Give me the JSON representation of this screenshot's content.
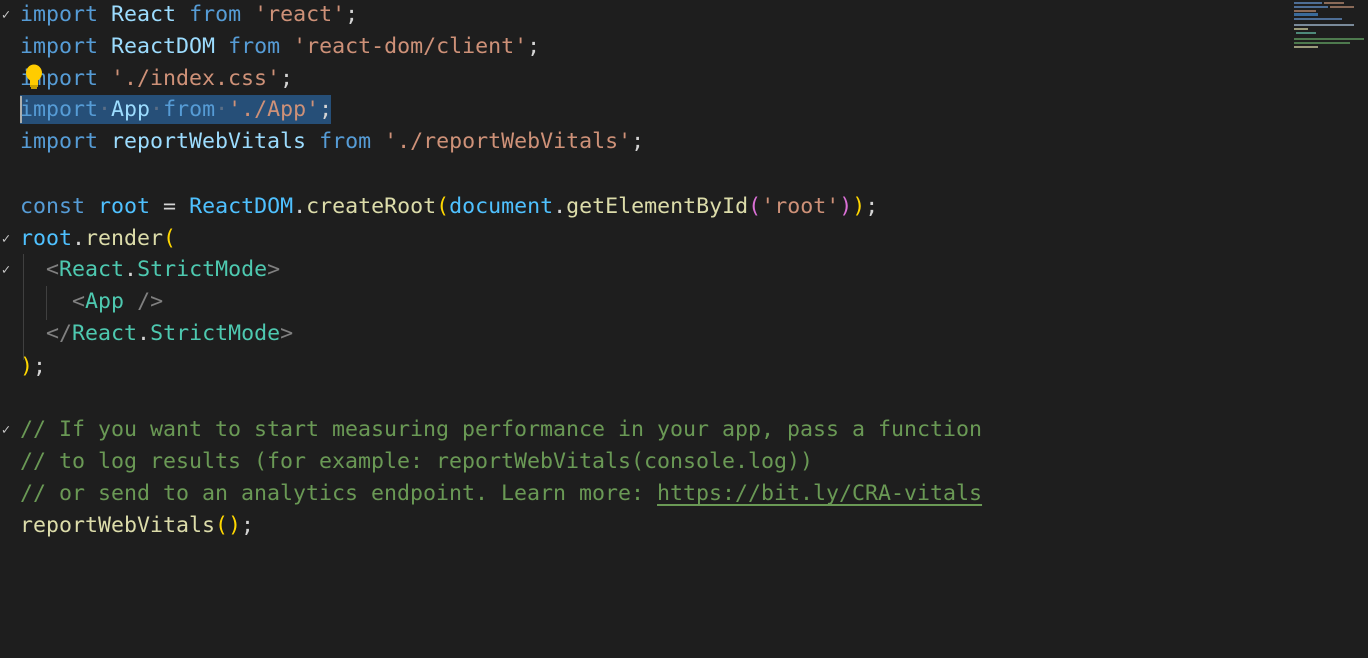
{
  "editor": {
    "lines": [
      {
        "fold": "✓",
        "tokens": [
          [
            "import",
            "kw"
          ],
          [
            " "
          ],
          [
            "React",
            "id"
          ],
          [
            " "
          ],
          [
            "from",
            "kw"
          ],
          [
            " "
          ],
          [
            "'react'",
            "str"
          ],
          [
            ";",
            "pun"
          ]
        ]
      },
      {
        "fold": "",
        "tokens": [
          [
            "import",
            "kw"
          ],
          [
            " "
          ],
          [
            "ReactDOM",
            "id"
          ],
          [
            " "
          ],
          [
            "from",
            "kw"
          ],
          [
            " "
          ],
          [
            "'react-dom/client'",
            "str"
          ],
          [
            ";",
            "pun"
          ]
        ]
      },
      {
        "fold": "",
        "tokens": [
          [
            "import",
            "kw"
          ],
          [
            " "
          ],
          [
            "'./index.css'",
            "str"
          ],
          [
            ";",
            "pun"
          ]
        ]
      },
      {
        "fold": "",
        "tokens": [
          [
            "import",
            "kw"
          ],
          [
            " "
          ],
          [
            "App",
            "id"
          ],
          [
            " "
          ],
          [
            "from",
            "kw"
          ],
          [
            " "
          ],
          [
            "'./App'",
            "str"
          ],
          [
            ";",
            "pun"
          ]
        ]
      },
      {
        "fold": "",
        "tokens": [
          [
            "import",
            "kw"
          ],
          [
            " "
          ],
          [
            "reportWebVitals",
            "id"
          ],
          [
            " "
          ],
          [
            "from",
            "kw"
          ],
          [
            " "
          ],
          [
            "'./reportWebVitals'",
            "str"
          ],
          [
            ";",
            "pun"
          ]
        ]
      },
      {
        "fold": "",
        "tokens": []
      },
      {
        "fold": "",
        "tokens": [
          [
            "const",
            "kw"
          ],
          [
            " "
          ],
          [
            "root",
            "var"
          ],
          [
            " = "
          ],
          [
            "ReactDOM",
            "var"
          ],
          [
            "."
          ],
          [
            "createRoot",
            "fn"
          ],
          [
            "(",
            "br1"
          ],
          [
            "document",
            "var"
          ],
          [
            "."
          ],
          [
            "getElementById",
            "fn"
          ],
          [
            "(",
            "br2"
          ],
          [
            "'root'",
            "str"
          ],
          [
            ")",
            "br2"
          ],
          [
            ")",
            "br1"
          ],
          [
            ";",
            "pun"
          ]
        ]
      },
      {
        "fold": "✓",
        "tokens": [
          [
            "root",
            "var"
          ],
          [
            "."
          ],
          [
            "render",
            "fn"
          ],
          [
            "(",
            "br1"
          ]
        ]
      },
      {
        "fold": "✓",
        "tokens": [
          [
            "  "
          ],
          [
            "<",
            "tag"
          ],
          [
            "React",
            "cmp"
          ],
          [
            "."
          ],
          [
            "StrictMode",
            "cmp"
          ],
          [
            ">",
            "tag"
          ]
        ]
      },
      {
        "fold": "",
        "tokens": [
          [
            "    "
          ],
          [
            "<",
            "tag"
          ],
          [
            "App",
            "cmp"
          ],
          [
            " "
          ],
          [
            "/>",
            "tag"
          ]
        ]
      },
      {
        "fold": "",
        "tokens": [
          [
            "  "
          ],
          [
            "</",
            "tag"
          ],
          [
            "React",
            "cmp"
          ],
          [
            "."
          ],
          [
            "StrictMode",
            "cmp"
          ],
          [
            ">",
            "tag"
          ]
        ]
      },
      {
        "fold": "",
        "tokens": [
          [
            ")",
            "br1"
          ],
          [
            ";",
            "pun"
          ]
        ]
      },
      {
        "fold": "",
        "tokens": []
      },
      {
        "fold": "✓",
        "tokens": [
          [
            "// If you want to start measuring performance in your app, pass a function",
            "cm"
          ]
        ]
      },
      {
        "fold": "",
        "tokens": [
          [
            "// to log results (for example: reportWebVitals(console.log))",
            "cm"
          ]
        ]
      },
      {
        "fold": "",
        "tokens": [
          [
            "// or send to an analytics endpoint. Learn more: ",
            "cm"
          ],
          [
            "https://bit.ly/CRA-vitals",
            "url"
          ]
        ]
      },
      {
        "fold": "",
        "tokens": [
          [
            "reportWebVitals",
            "fn"
          ],
          [
            "(",
            "br1"
          ],
          [
            ")",
            "br1"
          ],
          [
            ";",
            "pun"
          ]
        ]
      }
    ],
    "selected_line": 4,
    "lightbulb_line": 3
  }
}
